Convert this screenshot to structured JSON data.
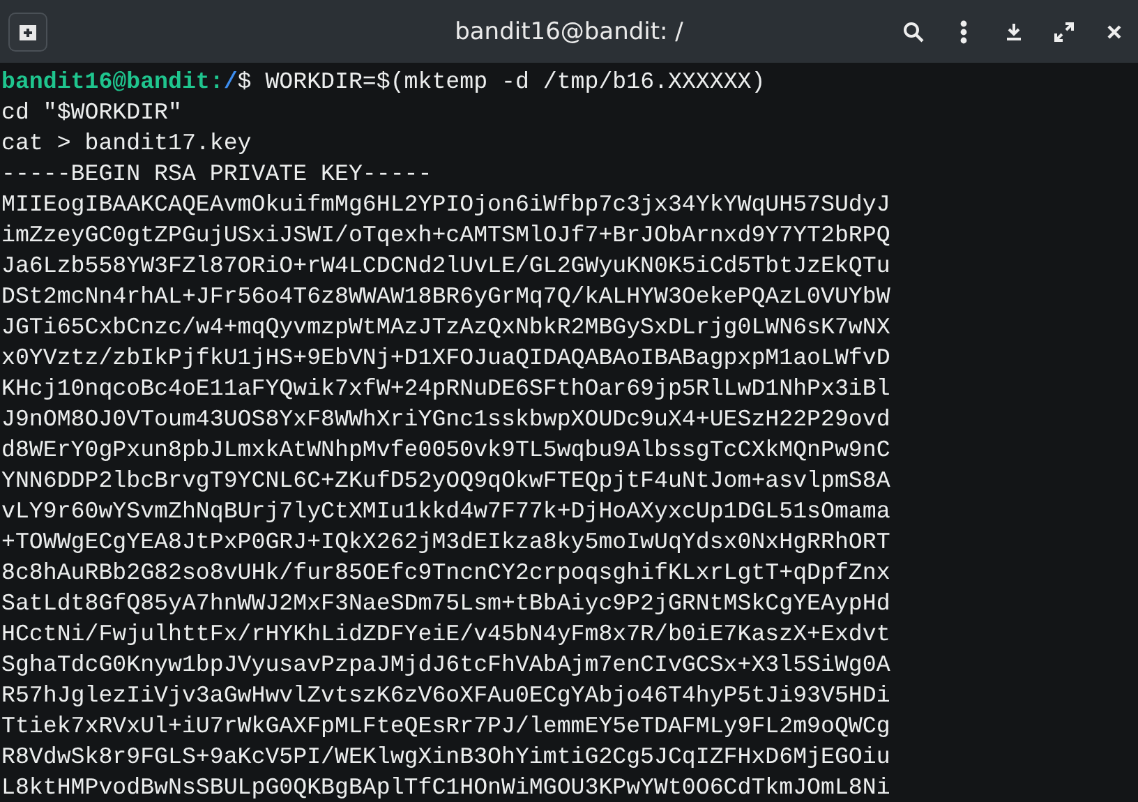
{
  "window": {
    "title": "bandit16@bandit: /"
  },
  "terminal": {
    "prompt": {
      "user_host": "bandit16@bandit:",
      "path": "/",
      "symbol": "$",
      "command": "WORKDIR=$(mktemp -d /tmp/b16.XXXXXX)"
    },
    "lines": [
      "cd \"$WORKDIR\"",
      "cat > bandit17.key",
      "-----BEGIN RSA PRIVATE KEY-----",
      "MIIEogIBAAKCAQEAvmOkuifmMg6HL2YPIOjon6iWfbp7c3jx34YkYWqUH57SUdyJ",
      "imZzeyGC0gtZPGujUSxiJSWI/oTqexh+cAMTSMlOJf7+BrJObArnxd9Y7YT2bRPQ",
      "Ja6Lzb558YW3FZl87ORiO+rW4LCDCNd2lUvLE/GL2GWyuKN0K5iCd5TbtJzEkQTu",
      "DSt2mcNn4rhAL+JFr56o4T6z8WWAW18BR6yGrMq7Q/kALHYW3OekePQAzL0VUYbW",
      "JGTi65CxbCnzc/w4+mqQyvmzpWtMAzJTzAzQxNbkR2MBGySxDLrjg0LWN6sK7wNX",
      "x0YVztz/zbIkPjfkU1jHS+9EbVNj+D1XFOJuaQIDAQABAoIBABagpxpM1aoLWfvD",
      "KHcj10nqcoBc4oE11aFYQwik7xfW+24pRNuDE6SFthOar69jp5RlLwD1NhPx3iBl",
      "J9nOM8OJ0VToum43UOS8YxF8WWhXriYGnc1sskbwpXOUDc9uX4+UESzH22P29ovd",
      "d8WErY0gPxun8pbJLmxkAtWNhpMvfe0050vk9TL5wqbu9AlbssgTcCXkMQnPw9nC",
      "YNN6DDP2lbcBrvgT9YCNL6C+ZKufD52yOQ9qOkwFTEQpjtF4uNtJom+asvlpmS8A",
      "vLY9r60wYSvmZhNqBUrj7lyCtXMIu1kkd4w7F77k+DjHoAXyxcUp1DGL51sOmama",
      "+TOWWgECgYEA8JtPxP0GRJ+IQkX262jM3dEIkza8ky5moIwUqYdsx0NxHgRRhORT",
      "8c8hAuRBb2G82so8vUHk/fur85OEfc9TncnCY2crpoqsghifKLxrLgtT+qDpfZnx",
      "SatLdt8GfQ85yA7hnWWJ2MxF3NaeSDm75Lsm+tBbAiyc9P2jGRNtMSkCgYEAypHd",
      "HCctNi/FwjulhttFx/rHYKhLidZDFYeiE/v45bN4yFm8x7R/b0iE7KaszX+Exdvt",
      "SghaTdcG0Knyw1bpJVyusavPzpaJMjdJ6tcFhVAbAjm7enCIvGCSx+X3l5SiWg0A",
      "R57hJglezIiVjv3aGwHwvlZvtszK6zV6oXFAu0ECgYAbjo46T4hyP5tJi93V5HDi",
      "Ttiek7xRVxUl+iU7rWkGAXFpMLFteQEsRr7PJ/lemmEY5eTDAFMLy9FL2m9oQWCg",
      "R8VdwSk8r9FGLS+9aKcV5PI/WEKlwgXinB3OhYimtiG2Cg5JCqIZFHxD6MjEGOiu",
      "L8ktHMPvodBwNsSBULpG0QKBgBAplTfC1HOnWiMGOU3KPwYWt0O6CdTkmJOmL8Ni"
    ]
  }
}
